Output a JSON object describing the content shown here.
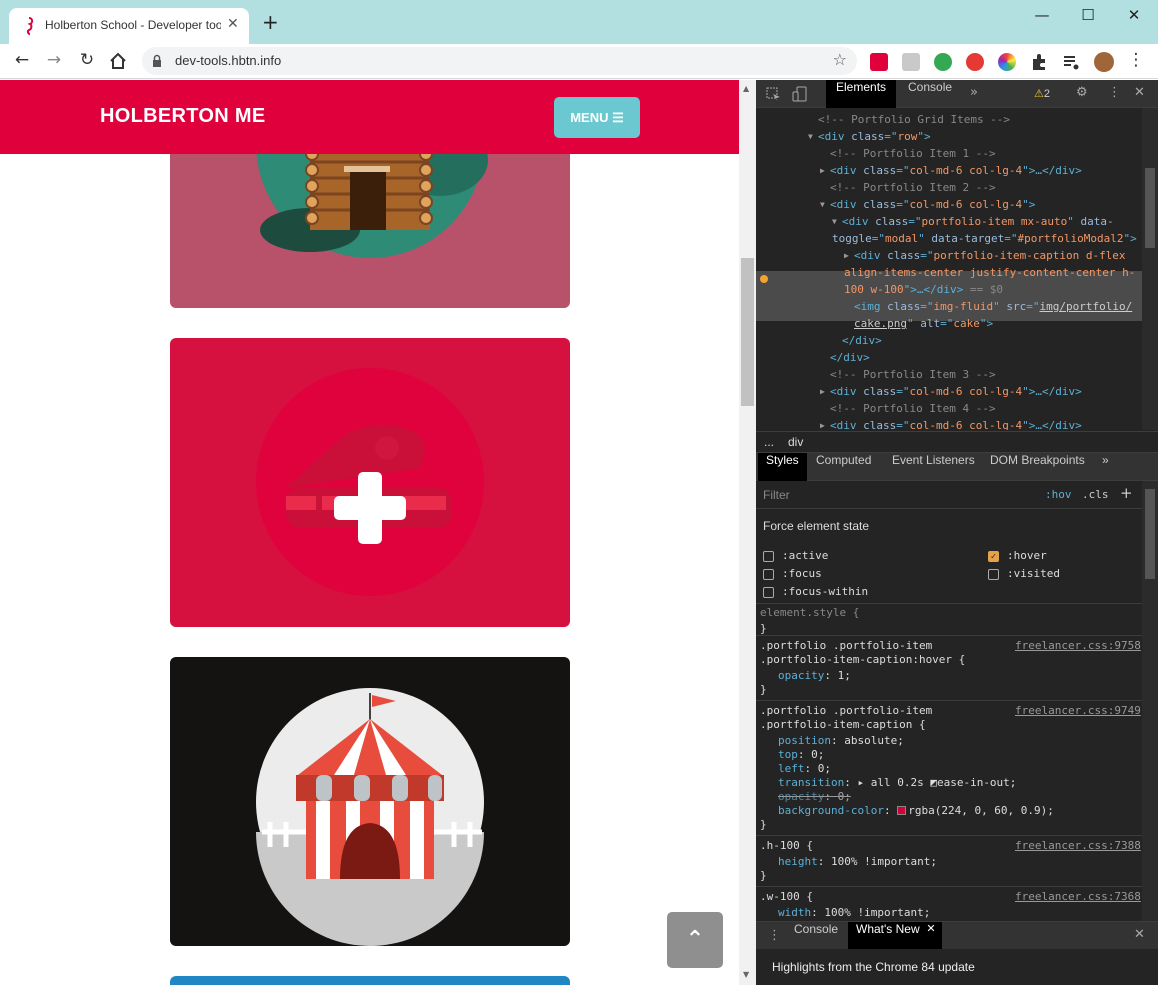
{
  "browser": {
    "tab_title": "Holberton School - Developer tools",
    "tab_close": "✕",
    "new_tab": "+",
    "url": "dev-tools.hbtn.info",
    "window": {
      "minimize": "—",
      "maximize": "☐",
      "close": "✕"
    }
  },
  "page": {
    "brand": "HOLBERTON ME",
    "menu_label": "MENU ☰",
    "back_to_top": "⌃",
    "colors": {
      "nav": "#e0003c",
      "menu": "#6cc8d0",
      "hover_overlay": "rgba(224, 0, 60, 0.9)"
    }
  },
  "devtools": {
    "tabs": [
      "Elements",
      "Console"
    ],
    "more_tabs": "»",
    "warnings": "2",
    "dom_lines": [
      {
        "indent": 62,
        "parts": [
          [
            "c",
            "<!-- Portfolio Grid Items -->"
          ]
        ]
      },
      {
        "indent": 62,
        "arrow": "▼",
        "parts": [
          [
            "t",
            "<div "
          ],
          [
            "a",
            "class"
          ],
          [
            "t",
            "=\""
          ],
          [
            "v",
            "row"
          ],
          [
            "t",
            "\">"
          ]
        ]
      },
      {
        "indent": 74,
        "parts": [
          [
            "c",
            "<!-- Portfolio Item 1 -->"
          ]
        ]
      },
      {
        "indent": 74,
        "arrow": "▶",
        "parts": [
          [
            "t",
            "<div "
          ],
          [
            "a",
            "class"
          ],
          [
            "t",
            "=\""
          ],
          [
            "v",
            "col-md-6 col-lg-4"
          ],
          [
            "t",
            "\">…</div>"
          ]
        ]
      },
      {
        "indent": 74,
        "parts": [
          [
            "c",
            "<!-- Portfolio Item 2 -->"
          ]
        ]
      },
      {
        "indent": 74,
        "arrow": "▼",
        "parts": [
          [
            "t",
            "<div "
          ],
          [
            "a",
            "class"
          ],
          [
            "t",
            "=\""
          ],
          [
            "v",
            "col-md-6 col-lg-4"
          ],
          [
            "t",
            "\">"
          ]
        ]
      },
      {
        "indent": 86,
        "arrow": "▼",
        "parts": [
          [
            "t",
            "<div "
          ],
          [
            "a",
            "class"
          ],
          [
            "t",
            "=\""
          ],
          [
            "v",
            "portfolio-item mx-auto"
          ],
          [
            "t",
            "\" "
          ],
          [
            "a",
            "data-"
          ]
        ]
      },
      {
        "indent": 76,
        "parts": [
          [
            "a",
            "toggle"
          ],
          [
            "t",
            "=\""
          ],
          [
            "v",
            "modal"
          ],
          [
            "t",
            "\" "
          ],
          [
            "a",
            "data-target"
          ],
          [
            "t",
            "=\""
          ],
          [
            "v",
            "#portfolioModal2"
          ],
          [
            "t",
            "\">"
          ]
        ]
      },
      {
        "indent": 98,
        "arrow": "▶",
        "parts": [
          [
            "t",
            "<div "
          ],
          [
            "a",
            "class"
          ],
          [
            "t",
            "=\""
          ],
          [
            "v",
            "portfolio-item-caption d-flex"
          ]
        ]
      },
      {
        "indent": 88,
        "parts": [
          [
            "v",
            "align-items-center justify-content-center h-"
          ]
        ]
      },
      {
        "indent": 88,
        "parts": [
          [
            "v",
            "100 w-100"
          ],
          [
            "t",
            "\">…</div>"
          ],
          [
            "c",
            " == $0"
          ]
        ]
      },
      {
        "indent": 98,
        "parts": [
          [
            "t",
            "<img "
          ],
          [
            "a",
            "class"
          ],
          [
            "t",
            "=\""
          ],
          [
            "v",
            "img-fluid"
          ],
          [
            "t",
            "\" "
          ],
          [
            "a",
            "src"
          ],
          [
            "t",
            "=\""
          ],
          [
            "u",
            "img/portfolio/"
          ]
        ]
      },
      {
        "indent": 98,
        "parts": [
          [
            "u",
            "cake.png"
          ],
          [
            "t",
            "\" "
          ],
          [
            "a",
            "alt"
          ],
          [
            "t",
            "=\""
          ],
          [
            "v",
            "cake"
          ],
          [
            "t",
            "\">"
          ]
        ]
      },
      {
        "indent": 86,
        "parts": [
          [
            "t",
            "</div>"
          ]
        ]
      },
      {
        "indent": 74,
        "parts": [
          [
            "t",
            "</div>"
          ]
        ]
      },
      {
        "indent": 74,
        "parts": [
          [
            "c",
            "<!-- Portfolio Item 3 -->"
          ]
        ]
      },
      {
        "indent": 74,
        "arrow": "▶",
        "parts": [
          [
            "t",
            "<div "
          ],
          [
            "a",
            "class"
          ],
          [
            "t",
            "=\""
          ],
          [
            "v",
            "col-md-6 col-lg-4"
          ],
          [
            "t",
            "\">…</div>"
          ]
        ]
      },
      {
        "indent": 74,
        "parts": [
          [
            "c",
            "<!-- Portfolio Item 4 -->"
          ]
        ]
      },
      {
        "indent": 74,
        "arrow": "▶",
        "parts": [
          [
            "t",
            "<div "
          ],
          [
            "a",
            "class"
          ],
          [
            "t",
            "=\""
          ],
          [
            "v",
            "col-md-6 col-lg-4"
          ],
          [
            "t",
            "\">…</div>"
          ]
        ]
      }
    ],
    "breadcrumbs": [
      "...",
      "div"
    ],
    "subtabs": [
      "Styles",
      "Computed",
      "Event Listeners",
      "DOM Breakpoints"
    ],
    "filter_placeholder": "Filter",
    "hov": ":hov",
    "cls": ".cls",
    "plus": "+",
    "force_state_title": "Force element state",
    "states": [
      {
        "label": ":active",
        "checked": false
      },
      {
        "label": ":hover",
        "checked": true
      },
      {
        "label": ":focus",
        "checked": false
      },
      {
        "label": ":visited",
        "checked": false
      },
      {
        "label": ":focus-within",
        "checked": false
      }
    ],
    "element_style": "element.style {",
    "close_brace": "}",
    "rules": [
      {
        "selector": [
          ".portfolio .portfolio-item",
          ".portfolio-item-caption:hover {"
        ],
        "source": "freelancer.css:9758",
        "props": [
          [
            "opacity",
            "1;"
          ]
        ]
      },
      {
        "selector": [
          ".portfolio .portfolio-item",
          ".portfolio-item-caption {"
        ],
        "source": "freelancer.css:9749",
        "props": [
          [
            "position",
            "absolute;"
          ],
          [
            "top",
            "0;"
          ],
          [
            "left",
            "0;"
          ],
          [
            "transition",
            "▸ all 0.2s ◩ease-in-out;"
          ],
          [
            "opacity",
            "0;"
          ],
          [
            "background-color",
            "rgba(224, 0, 60, 0.9);"
          ]
        ]
      },
      {
        "selector": [
          ".h-100 {"
        ],
        "source": "freelancer.css:7388",
        "props": [
          [
            "height",
            "100% !important;"
          ]
        ]
      },
      {
        "selector": [
          ".w-100 {"
        ],
        "source": "freelancer.css:7368",
        "props": [
          [
            "width",
            "100% !important;"
          ]
        ]
      }
    ],
    "drawer_tabs": [
      "Console",
      "What's New"
    ],
    "drawer_message": "Highlights from the Chrome 84 update"
  }
}
